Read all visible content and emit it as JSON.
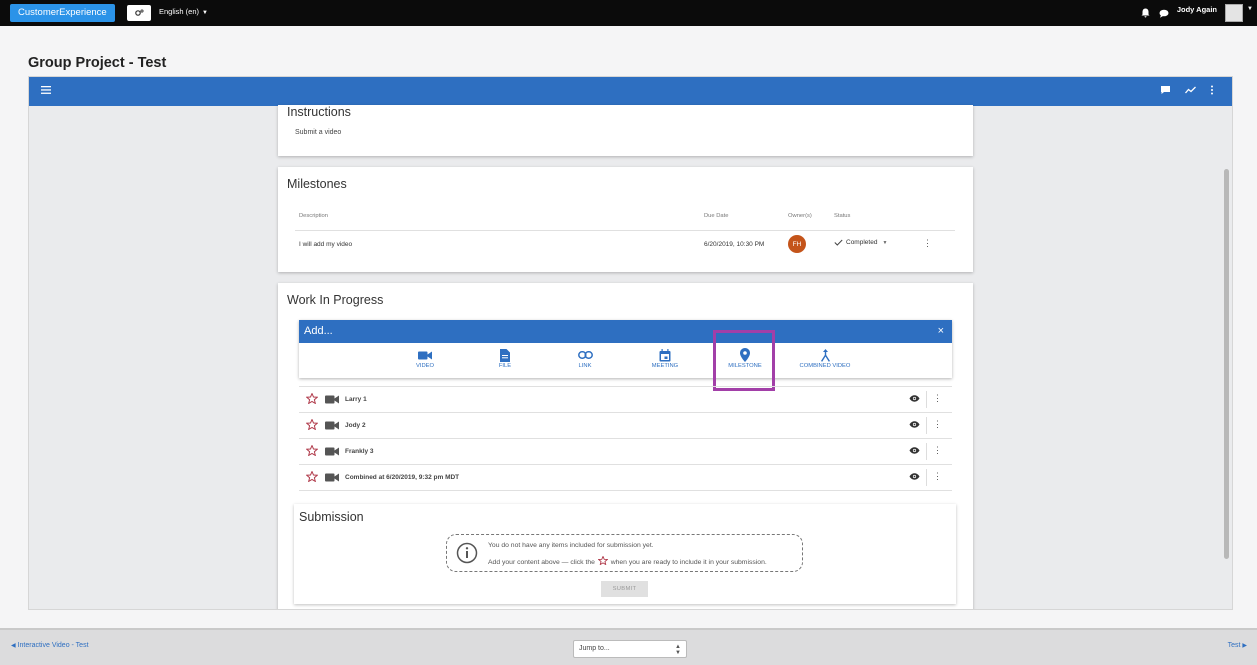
{
  "topnav": {
    "brand": "CustomerExperience",
    "language": "English (en)",
    "username": "Jody Again"
  },
  "page": {
    "title": "Group Project - Test"
  },
  "instructions": {
    "title": "Instructions",
    "body": "Submit a video"
  },
  "milestones": {
    "title": "Milestones",
    "columns": [
      "Description",
      "Due Date",
      "Owner(s)",
      "Status"
    ],
    "rows": [
      {
        "description": "I will add my video",
        "due": "6/20/2019, 10:30 PM",
        "owner_initials": "FH",
        "status": "Completed"
      }
    ]
  },
  "wip": {
    "title": "Work In Progress",
    "add_title": "Add...",
    "add_close": "×",
    "options": [
      {
        "label": "VIDEO",
        "icon": "video-icon"
      },
      {
        "label": "FILE",
        "icon": "file-icon"
      },
      {
        "label": "LINK",
        "icon": "link-icon"
      },
      {
        "label": "MEETING",
        "icon": "calendar-icon"
      },
      {
        "label": "MILESTONE",
        "icon": "location-pin-icon"
      },
      {
        "label": "COMBINED VIDEO",
        "icon": "merge-icon"
      }
    ],
    "items": [
      {
        "name": "Larry 1"
      },
      {
        "name": "Jody 2"
      },
      {
        "name": "Frankly 3"
      },
      {
        "name": "Combined at 6/20/2019, 9:32 pm MDT"
      }
    ]
  },
  "submission": {
    "title": "Submission",
    "notice_line1": "You do not have any items included for submission yet.",
    "notice_line2_a": "Add your content above — click the",
    "notice_line2_b": "when you are ready to include it in your submission.",
    "submit_label": "SUBMIT"
  },
  "bottombar": {
    "prev": "Interactive Video - Test",
    "jump": "Jump to...",
    "next": "Test"
  },
  "colors": {
    "brand": "#2b93e8",
    "primary_blue": "#2e6fc1",
    "highlight_purple": "#a23fa8",
    "star_red": "#b03a4a",
    "owner_badge": "#c4541a"
  }
}
